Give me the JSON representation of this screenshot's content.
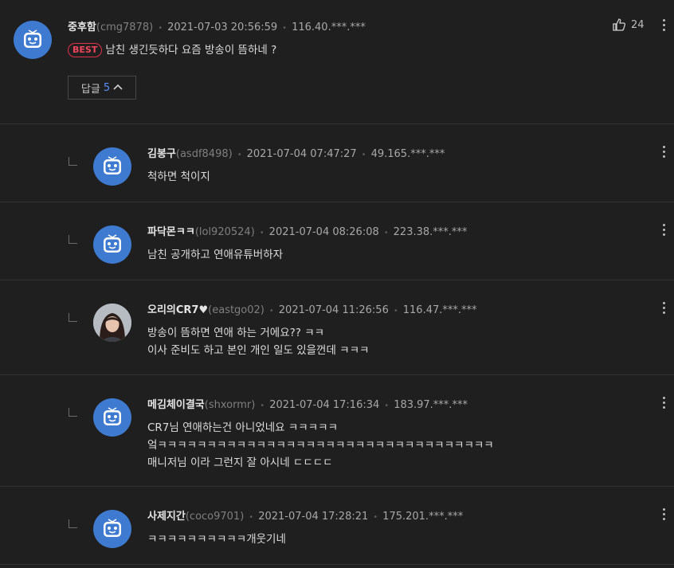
{
  "main": {
    "nickname": "중후함",
    "userid": "(cmg7878)",
    "date": "2021-07-03 20:56:59",
    "ip": "116.40.***.***",
    "best_label": "BEST",
    "text": "남친 생긴듯하다 요즘 방송이 뜸하네 ?",
    "likes": "24",
    "reply_label": "답글",
    "reply_count": "5"
  },
  "replies": [
    {
      "nickname": "김봉구",
      "userid": "(asdf8498)",
      "date": "2021-07-04 07:47:27",
      "ip": "49.165.***.***",
      "lines": [
        "척하면 척이지"
      ]
    },
    {
      "nickname": "파닥몬ㅋㅋ",
      "userid": "(lol920524)",
      "date": "2021-07-04 08:26:08",
      "ip": "223.38.***.***",
      "lines": [
        "남친 공개하고 연애유튜버하자"
      ]
    },
    {
      "nickname": "오리의CR7♥",
      "userid": "(eastgo02)",
      "date": "2021-07-04 11:26:56",
      "ip": "116.47.***.***",
      "lines": [
        "방송이 뜸하면 연애 하는 거에요?? ㅋㅋ",
        "이사 준비도 하고 본인 개인 일도 있을껀데 ㅋㅋㅋ"
      ]
    },
    {
      "nickname": "메김체이결국",
      "userid": "(shxormr)",
      "date": "2021-07-04 17:16:34",
      "ip": "183.97.***.***",
      "lines": [
        "CR7님 연애하는건 아니었네요 ㅋㅋㅋㅋㅋ",
        "엌ㅋㅋㅋㅋㅋㅋㅋㅋㅋㅋㅋㅋㅋㅋㅋㅋㅋㅋㅋㅋㅋㅋㅋㅋㅋㅋㅋㅋㅋㅋㅋㅋㅋㅋ",
        "매니저님 이라 그런지 잘 아시네 ㄷㄷㄷㄷ"
      ]
    },
    {
      "nickname": "사제지간",
      "userid": "(coco9701)",
      "date": "2021-07-04 17:28:21",
      "ip": "175.201.***.***",
      "lines": [
        "ㅋㅋㅋㅋㅋㅋㅋㅋㅋㅋ개웃기네"
      ]
    }
  ]
}
